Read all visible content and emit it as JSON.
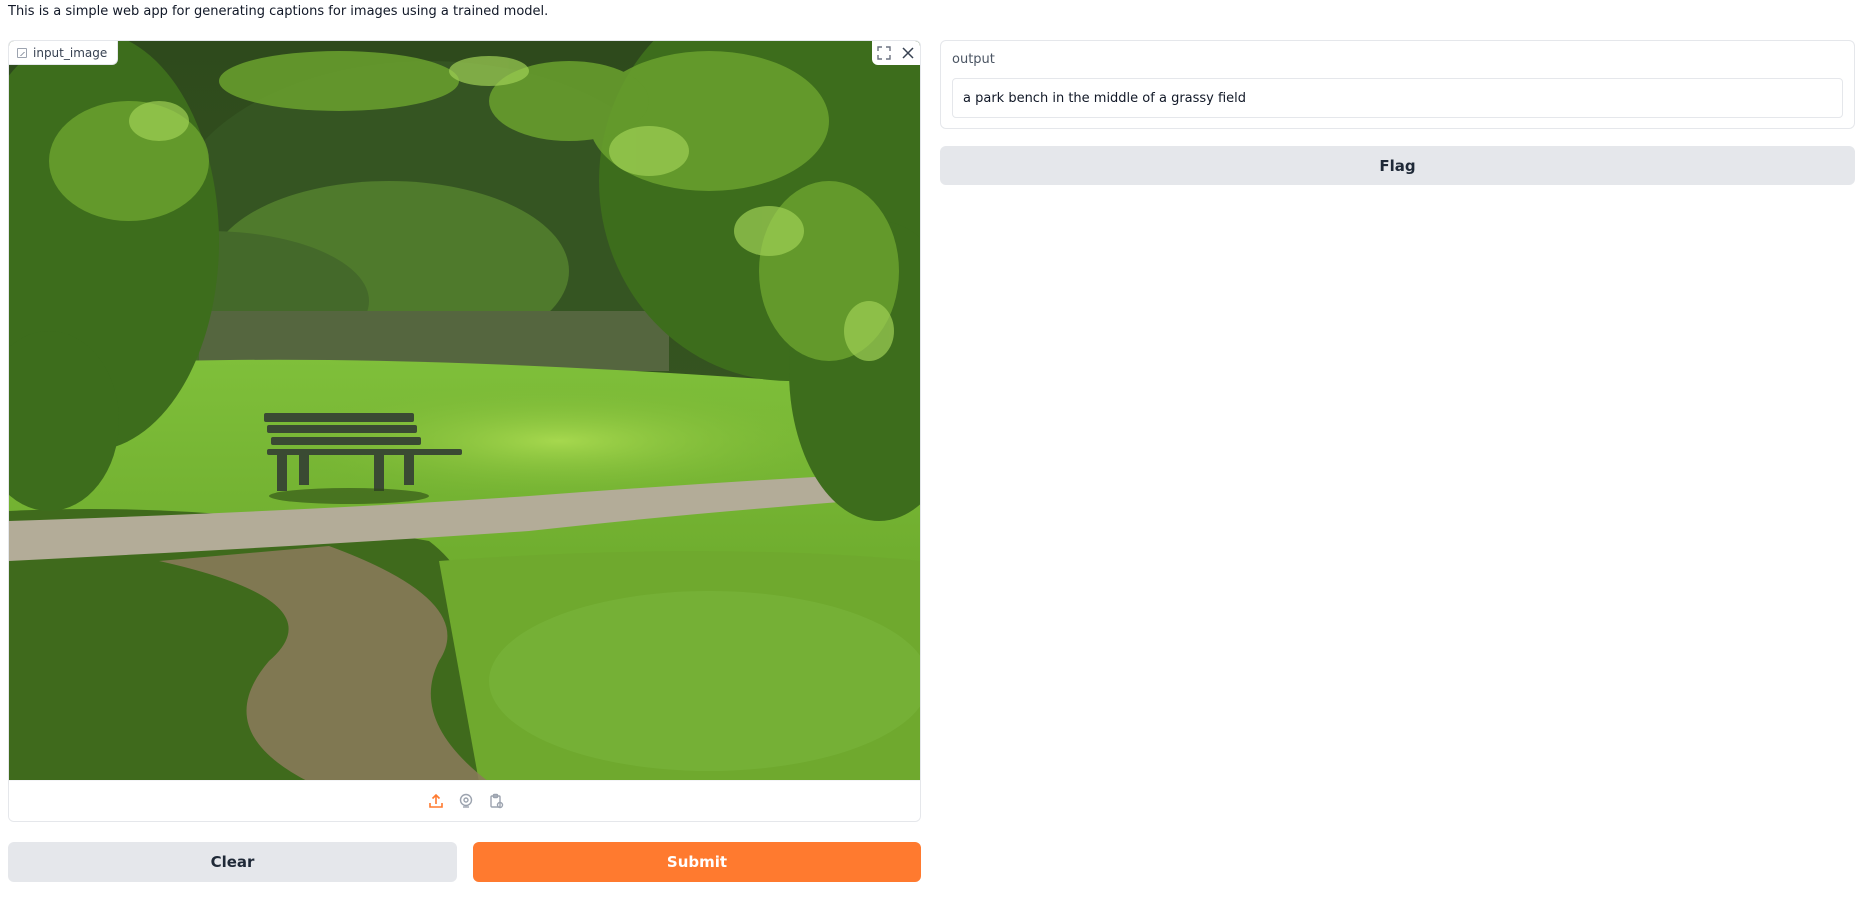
{
  "description": "This is a simple web app for generating captions for images using a trained model.",
  "input_image": {
    "label": "input_image",
    "label_icon": "image-icon",
    "fullscreen_icon": "fullscreen-icon",
    "close_icon": "close-icon",
    "toolbar_icons": [
      "upload-icon",
      "webcam-icon",
      "clipboard-icon"
    ],
    "accent_color": "#ff7a2f"
  },
  "output": {
    "label": "output",
    "value": "a park bench in the middle of a grassy field"
  },
  "buttons": {
    "clear": "Clear",
    "submit": "Submit",
    "flag": "Flag"
  },
  "colors": {
    "primary": "#ff7a2f",
    "secondary": "#e5e7eb"
  }
}
